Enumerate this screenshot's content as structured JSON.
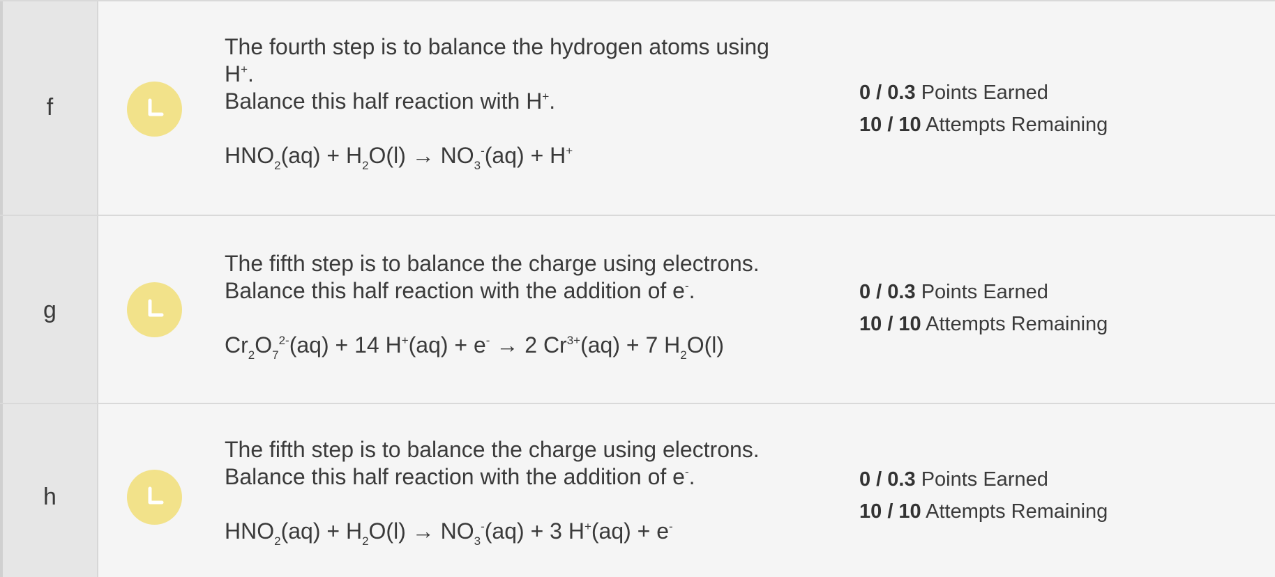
{
  "parts": [
    {
      "letter": "f",
      "status": "clock-icon",
      "instruction_line1": "The fourth step is to balance the hydrogen atoms using",
      "instruction_line2_main": "H",
      "instruction_line2_sup": "+",
      "instruction_line2_end": ".",
      "instruction_line3_main": "Balance this half reaction with H",
      "instruction_line3_sup": "+",
      "instruction_line3_end": ".",
      "equation": {
        "t1": "HNO",
        "s1": "2",
        "t2": "(aq) + H",
        "s2": "2",
        "t3": "O(l) → NO",
        "s3": "3",
        "p3": "-",
        "t4": "(aq) + H",
        "p4": "+"
      },
      "points_score": "0 / 0.3",
      "points_label": "Points Earned",
      "attempts_score": "10 / 10",
      "attempts_label": "Attempts Remaining"
    },
    {
      "letter": "g",
      "status": "clock-icon",
      "instruction_line1": "The fifth step is to balance the charge using electrons.",
      "instruction_line2_main": "Balance this half reaction with the addition of e",
      "instruction_line2_sup": "-",
      "instruction_line2_end": ".",
      "equation": {
        "t1": "Cr",
        "s1": "2",
        "t2": "O",
        "s2": "7",
        "p2": "2-",
        "t3": "(aq) + 14 H",
        "p3": "+",
        "t4": "(aq) + e",
        "p4": "-",
        "t5": " → 2 Cr",
        "p5": "3+",
        "t6": "(aq) + 7 H",
        "s6": "2",
        "t7": "O(l)"
      },
      "points_score": "0 / 0.3",
      "points_label": "Points Earned",
      "attempts_score": "10 / 10",
      "attempts_label": "Attempts Remaining"
    },
    {
      "letter": "h",
      "status": "clock-icon",
      "instruction_line1": "The fifth step is to balance the charge using electrons.",
      "instruction_line2_main": "Balance this half reaction with the addition of e",
      "instruction_line2_sup": "-",
      "instruction_line2_end": ".",
      "equation": {
        "t1": "HNO",
        "s1": "2",
        "t2": "(aq) + H",
        "s2": "2",
        "t3": "O(l) → NO",
        "s3": "3",
        "p3": "-",
        "t4": "(aq) + 3 H",
        "p4": "+",
        "t5": "(aq) + e",
        "p5": "-"
      },
      "points_score": "0 / 0.3",
      "points_label": "Points Earned",
      "attempts_score": "10 / 10",
      "attempts_label": "Attempts Remaining"
    }
  ],
  "colors": {
    "background": "#f5f5f5",
    "letter_column": "#e6e6e6",
    "status_pending": "#f2e28a",
    "text": "#3a3a3a"
  }
}
